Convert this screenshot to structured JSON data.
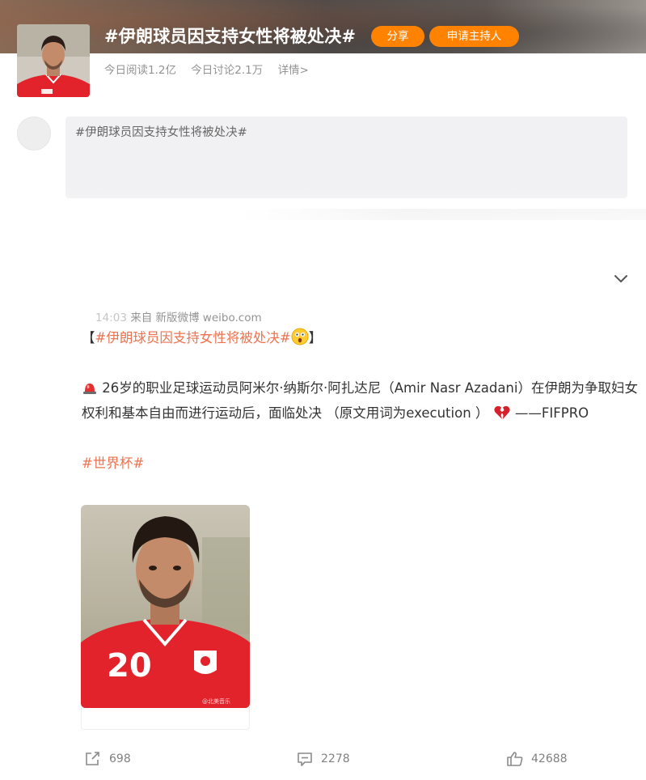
{
  "topic": {
    "title": "#伊朗球员因支持女性将被处决#",
    "share_label": "分享",
    "apply_host_label": "申请主持人",
    "reads": "今日阅读1.2亿",
    "discussions": "今日讨论2.1万",
    "detail_link": "详情>"
  },
  "compose": {
    "text": "#伊朗球员因支持女性将被处决#"
  },
  "post": {
    "time": "14:03",
    "source": "来自 新版微博 weibo.com",
    "bracket_open": "【",
    "topic_tag": "#伊朗球员因支持女性将被处决#",
    "bracket_close": "】",
    "body_line": "26岁的职业足球运动员阿米尔·纳斯尔·阿扎达尼（Amir Nasr Azadani）在伊朗为争取妇女权利和基本自由而进行运动后，面临处决 （原文用词为execution ）",
    "body_tail": "——FIFPRO",
    "hashtag": "#世界杯#",
    "image_jersey_number": "20",
    "image_watermark": "@北美音乐",
    "reposts": "698",
    "comments": "2278",
    "likes": "42688"
  },
  "colors": {
    "accent_orange": "#ff8200",
    "link_orange": "#eb7350",
    "jersey_red": "#e2232b"
  }
}
